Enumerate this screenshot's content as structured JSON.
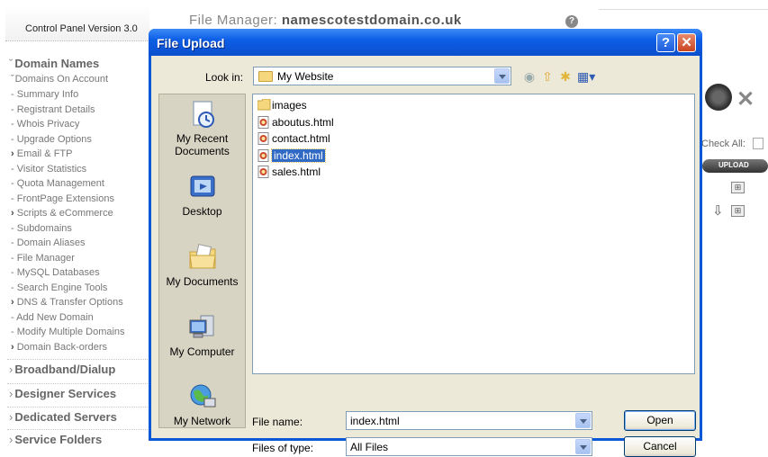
{
  "control_panel": {
    "version": "Control Panel Version 3.0",
    "header_prefix": "File Manager: ",
    "header_domain": "namescotestdomain.co.uk",
    "help": "?",
    "nav": [
      {
        "label": "Domain Names",
        "kind": "section open"
      },
      {
        "label": "Domains On Account",
        "kind": "expand"
      },
      {
        "label": "Summary Info",
        "kind": "sub"
      },
      {
        "label": "Registrant Details",
        "kind": "sub"
      },
      {
        "label": "Whois Privacy",
        "kind": "sub"
      },
      {
        "label": "Upgrade Options",
        "kind": "sub"
      },
      {
        "label": "Email & FTP",
        "kind": "arrow"
      },
      {
        "label": "Visitor Statistics",
        "kind": "sub"
      },
      {
        "label": "Quota Management",
        "kind": "sub"
      },
      {
        "label": "FrontPage Extensions",
        "kind": "sub"
      },
      {
        "label": "Scripts & eCommerce",
        "kind": "arrow"
      },
      {
        "label": "Subdomains",
        "kind": "sub"
      },
      {
        "label": "Domain Aliases",
        "kind": "sub"
      },
      {
        "label": "File Manager",
        "kind": "sub"
      },
      {
        "label": "MySQL Databases",
        "kind": "sub"
      },
      {
        "label": "Search Engine Tools",
        "kind": "sub"
      },
      {
        "label": "DNS & Transfer Options",
        "kind": "arrow"
      },
      {
        "label": "Add New Domain",
        "kind": "sub"
      },
      {
        "label": "Modify Multiple Domains",
        "kind": "sub"
      },
      {
        "label": "Domain Back-orders",
        "kind": "arrow"
      },
      {
        "label": "Broadband/Dialup",
        "kind": "section"
      },
      {
        "label": "Designer Services",
        "kind": "section"
      },
      {
        "label": "Dedicated Servers",
        "kind": "section"
      },
      {
        "label": "Service Folders",
        "kind": "section"
      }
    ],
    "check_all": "Check All:",
    "upload_button": "UPLOAD"
  },
  "dialog": {
    "title": "File Upload",
    "help_button": "?",
    "close_button": "✕",
    "look_in_label": "Look in:",
    "look_in_value": "My Website",
    "places": [
      "My Recent Documents",
      "Desktop",
      "My Documents",
      "My Computer",
      "My Network"
    ],
    "files": [
      {
        "name": "images",
        "type": "folder",
        "selected": false
      },
      {
        "name": "aboutus.html",
        "type": "html",
        "selected": false
      },
      {
        "name": "contact.html",
        "type": "html",
        "selected": false
      },
      {
        "name": "index.html",
        "type": "html",
        "selected": true
      },
      {
        "name": "sales.html",
        "type": "html",
        "selected": false
      }
    ],
    "file_name_label": "File name:",
    "file_name_value": "index.html",
    "files_of_type_label": "Files of type:",
    "files_of_type_value": "All Files",
    "open_button": "Open",
    "cancel_button": "Cancel"
  },
  "colors": {
    "titlebar": "#0a57d8",
    "dialog_face": "#ece9d8",
    "selection": "#316ac5"
  }
}
